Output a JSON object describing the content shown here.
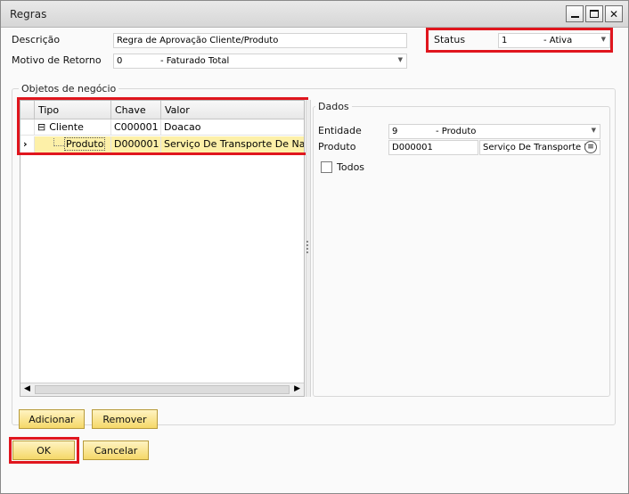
{
  "window": {
    "title": "Regras"
  },
  "header": {
    "descricao_label": "Descrição",
    "descricao_value": "Regra de Aprovação Cliente/Produto",
    "motivo_label": "Motivo de Retorno",
    "motivo_code": "0",
    "motivo_desc": "- Faturado Total",
    "status_label": "Status",
    "status_code": "1",
    "status_desc": "- Ativa"
  },
  "objetos": {
    "legend": "Objetos de negócio",
    "columns": [
      "Tipo",
      "Chave",
      "Valor"
    ],
    "rows": [
      {
        "tipo": "Cliente",
        "chave": "C000001",
        "valor": "Doacao",
        "expand": "⊟"
      },
      {
        "tipo": "Produto",
        "chave": "D000001",
        "valor": "Serviço De Transporte De Nature"
      }
    ],
    "row_indicator": "›"
  },
  "dados": {
    "legend": "Dados",
    "entidade_label": "Entidade",
    "entidade_code": "9",
    "entidade_desc": "- Produto",
    "produto_label": "Produto",
    "produto_code": "D000001",
    "produto_desc": "Serviço De Transporte D",
    "todos_label": "Todos"
  },
  "buttons": {
    "adicionar": "Adicionar",
    "remover": "Remover",
    "ok": "OK",
    "cancelar": "Cancelar"
  },
  "icons": {
    "minimize": "minimize-icon",
    "maximize": "maximize-icon",
    "close": "close-icon"
  }
}
